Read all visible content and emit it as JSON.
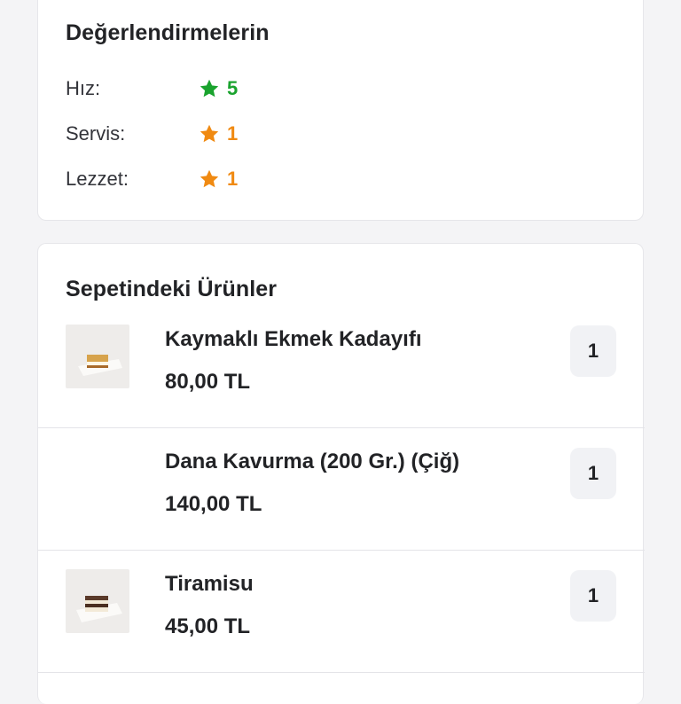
{
  "ratings": {
    "title": "Değerlendirmelerin",
    "items": [
      {
        "label": "Hız:",
        "value": "5",
        "color": "#1aa32e",
        "icon": "star-icon"
      },
      {
        "label": "Servis:",
        "value": "1",
        "color": "#f08a12",
        "icon": "star-icon"
      },
      {
        "label": "Lezzet:",
        "value": "1",
        "color": "#f08a12",
        "icon": "star-icon"
      }
    ]
  },
  "cart": {
    "title": "Sepetindeki Ürünler",
    "items": [
      {
        "name": "Kaymaklı Ekmek Kadayıfı",
        "price": "80,00 TL",
        "quantity": "1",
        "has_image": true,
        "image": "kadayif-thumbnail"
      },
      {
        "name": "Dana Kavurma (200 Gr.) (Çiğ)",
        "price": "140,00 TL",
        "quantity": "1",
        "has_image": false
      },
      {
        "name": "Tiramisu",
        "price": "45,00 TL",
        "quantity": "1",
        "has_image": true,
        "image": "tiramisu-thumbnail"
      }
    ]
  }
}
